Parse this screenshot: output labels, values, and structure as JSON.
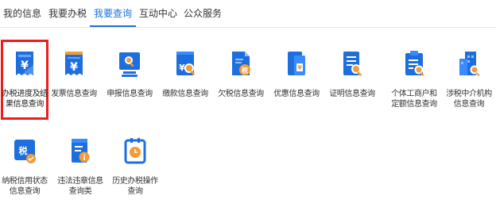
{
  "tabs": [
    "我的信息",
    "我要办税",
    "我要查询",
    "互动中心",
    "公众服务"
  ],
  "active_tab": "我要查询",
  "accent_color": "#1e6fdd",
  "selection_color": "#ee1c1c",
  "tiles": [
    {
      "label": "办税进度及结果信息查询",
      "icon": "yuan-receipt-icon"
    },
    {
      "label": "发票信息查询",
      "icon": "yuan-invoice-icon"
    },
    {
      "label": "申报信息查询",
      "icon": "monitor-search-icon"
    },
    {
      "label": "缴款信息查询",
      "icon": "payment-magnifier-icon"
    },
    {
      "label": "欠税信息查询",
      "icon": "tax-arrears-document-icon"
    },
    {
      "label": "优惠信息查询",
      "icon": "preferential-document-icon"
    },
    {
      "label": "证明信息查询",
      "icon": "certificate-search-icon"
    },
    {
      "label": "个体工商户和定额信息查询",
      "icon": "business-search-icon"
    },
    {
      "label": "涉税中介机构信息查询",
      "icon": "building-search-icon"
    },
    {
      "label": "纳税信用状态信息查询",
      "icon": "tax-credit-check-icon"
    },
    {
      "label": "违法违章信息查询类",
      "icon": "violation-info-icon"
    },
    {
      "label": "历史办税操作查询",
      "icon": "history-clock-icon"
    }
  ],
  "icon_glyphs": {
    "yuan": "¥",
    "tax": "税",
    "info": "i"
  }
}
